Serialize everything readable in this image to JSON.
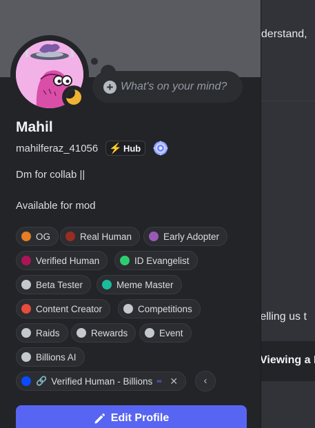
{
  "background": {
    "line1": "nderstand,",
    "line2": ", telling us t",
    "viewing_label": "Viewing a R"
  },
  "profile": {
    "display_name": "Mahil",
    "username": "mahilferaz_41056",
    "guild_tag": "Hub",
    "status": "idle",
    "thought_placeholder": "What's on your mind?",
    "bio_line1": "Dm for collab ||",
    "bio_line2": "Available for mod"
  },
  "roles": [
    {
      "label": "OG",
      "color": "#e67e22"
    },
    {
      "label": "Real Human",
      "color": "#992d22"
    },
    {
      "label": "Early Adopter",
      "color": "#9b59b6"
    },
    {
      "label": "Verified Human",
      "color": "#ad1457"
    },
    {
      "label": "ID Evangelist",
      "color": "#2ecc71"
    },
    {
      "label": "Beta Tester",
      "color": "#c4c9ce"
    },
    {
      "label": "Meme Master",
      "color": "#1abc9c"
    },
    {
      "label": "Content Creator",
      "color": "#e74c3c"
    },
    {
      "label": "Competitions",
      "color": "#c4c9ce"
    },
    {
      "label": "Raids",
      "color": "#c4c9ce"
    },
    {
      "label": "Rewards",
      "color": "#c4c9ce"
    },
    {
      "label": "Event",
      "color": "#c4c9ce"
    },
    {
      "label": "Billions AI",
      "color": "#c4c9ce"
    },
    {
      "label": "Verified Human - Billions",
      "color": "#0a4bff"
    }
  ],
  "actions": {
    "edit_profile": "Edit Profile"
  }
}
